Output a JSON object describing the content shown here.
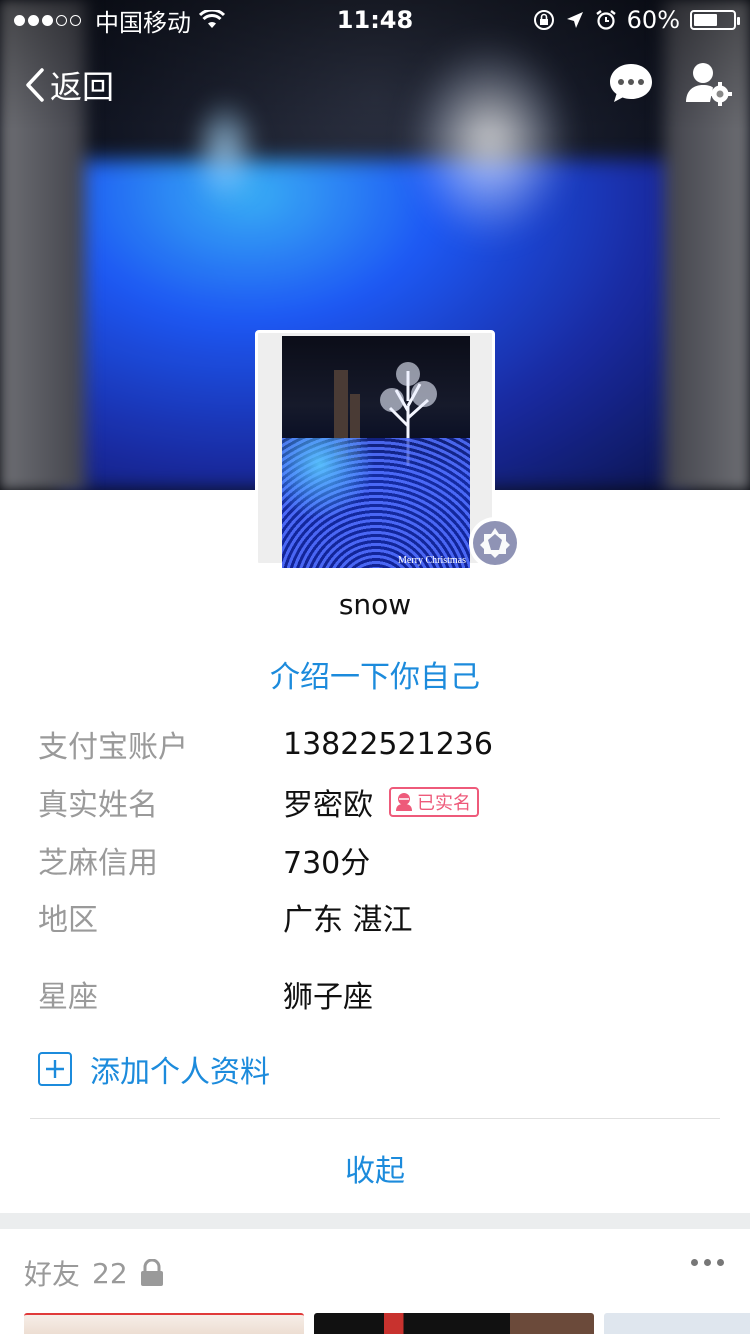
{
  "status_bar": {
    "carrier": "中国移动",
    "time": "11:48",
    "battery_text": "60%",
    "battery_level": 0.6
  },
  "nav": {
    "back_label": "返回",
    "icons": [
      "chat-bubble-icon",
      "person-settings-icon"
    ]
  },
  "profile": {
    "avatar_caption": "Merry Christmas",
    "name": "snow",
    "intro_link": "介绍一下你自己",
    "rows": [
      {
        "label": "支付宝账户",
        "value": "13822521236"
      },
      {
        "label": "真实姓名",
        "value": "罗密欧",
        "badge": "已实名"
      },
      {
        "label": "芝麻信用",
        "value": "730分"
      },
      {
        "label": "地区",
        "value": "广东 湛江"
      },
      {
        "label": "星座",
        "value": "狮子座"
      }
    ],
    "add_info": "添加个人资料",
    "collapse": "收起"
  },
  "friends": {
    "title": "好友",
    "count": "22"
  },
  "colors": {
    "accent": "#1c8bdc",
    "badge": "#ee5a7a"
  }
}
